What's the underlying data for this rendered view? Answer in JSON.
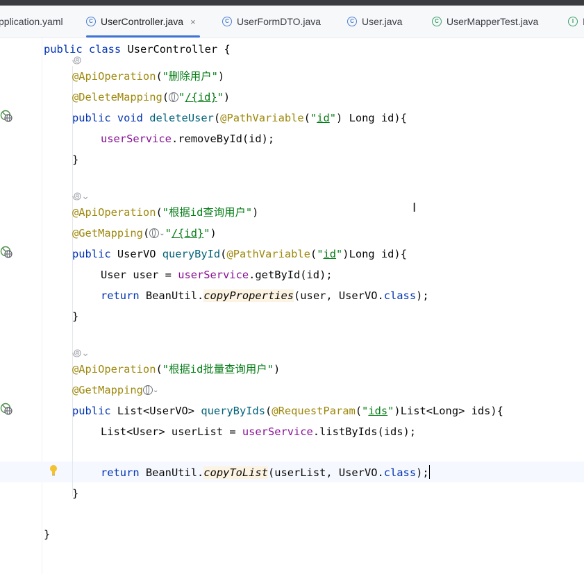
{
  "tabs": [
    {
      "label": "pplication.yaml",
      "icon": "yaml-file-icon",
      "active": false
    },
    {
      "label": "UserController.java",
      "icon": "java-class-icon",
      "active": true,
      "close": "×"
    },
    {
      "label": "UserFormDTO.java",
      "icon": "java-class-icon",
      "active": false
    },
    {
      "label": "User.java",
      "icon": "java-class-icon",
      "active": false
    },
    {
      "label": "UserMapperTest.java",
      "icon": "java-test-class-icon",
      "active": false
    },
    {
      "label": "I",
      "icon": "java-interface-icon",
      "active": false
    }
  ],
  "code": {
    "l1": {
      "kw": "public class ",
      "name": "UserController {"
    },
    "l2": {
      "ann": "@ApiOperation",
      "p1": "(",
      "str": "\"删除用户\"",
      "p2": ")"
    },
    "l3": {
      "ann": "@DeleteMapping",
      "p1": "(",
      "str1": "\"",
      "str2": "/{id}",
      "str3": "\"",
      "p2": ")"
    },
    "l4": {
      "kw1": "public ",
      "kw2": "void ",
      "fn": "deleteUser",
      "p1": "(",
      "ann": "@PathVariable",
      "p2": "(",
      "s1": "\"",
      "s2": "id",
      "s3": "\"",
      "p3": ") Long id){"
    },
    "l5": {
      "fld": "userService",
      "rest": ".removeById(id);"
    },
    "l6": {
      "text": "}"
    },
    "l7": {
      "ann": "@ApiOperation",
      "p1": "(",
      "str": "\"根据id查询用户\"",
      "p2": ")"
    },
    "l8": {
      "ann": "@GetMapping",
      "p1": "(",
      "str1": "\"",
      "str2": "/{id}",
      "str3": "\"",
      "p2": ")"
    },
    "l9": {
      "kw1": "public ",
      "type": "UserVO ",
      "fn": "queryById",
      "p1": "(",
      "ann": "@PathVariable",
      "p2": "(",
      "s1": "\"",
      "s2": "id",
      "s3": "\"",
      "p3": ")Long id){"
    },
    "l10": {
      "t1": "User user = ",
      "fld": "userService",
      "rest": ".getById(id);"
    },
    "l11": {
      "kw": "return ",
      "t1": "BeanUtil.",
      "ital": "copyProperties",
      "t2": "(user, UserVO.",
      "kw2": "class",
      "t3": ");"
    },
    "l12": {
      "text": "}"
    },
    "l13": {
      "ann": "@ApiOperation",
      "p1": "(",
      "str": "\"根据id批量查询用户\"",
      "p2": ")"
    },
    "l14": {
      "ann": "@GetMapping"
    },
    "l15": {
      "kw1": "public ",
      "type": "List<UserVO> ",
      "fn": "queryByIds",
      "p1": "(",
      "ann": "@RequestParam",
      "p2": "(",
      "s1": "\"",
      "s2": "ids",
      "s3": "\"",
      "p3": ")List<Long> ids){"
    },
    "l16": {
      "t1": "List<User> userList = ",
      "fld": "userService",
      "rest": ".listByIds(ids);"
    },
    "l17": {
      "kw": "return ",
      "t1": "BeanUtil.",
      "ital": "copyToList",
      "t2": "(userList, UserVO.",
      "kw2": "class",
      "t3": ");"
    },
    "l18": {
      "text": "}"
    },
    "l19": {
      "text": "}"
    }
  }
}
